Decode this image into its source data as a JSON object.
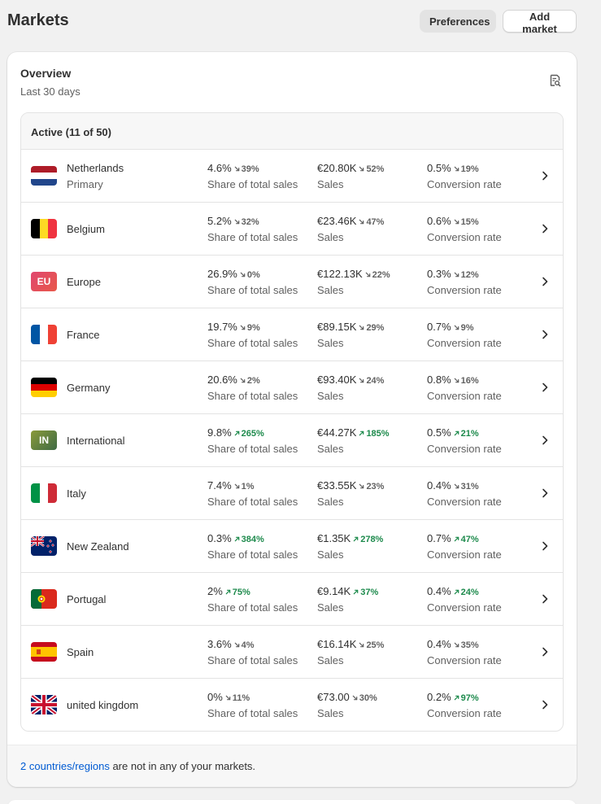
{
  "header": {
    "title": "Markets",
    "preferences_label": "Preferences",
    "add_market_label": "Add market"
  },
  "overview": {
    "title": "Overview",
    "period": "Last 30 days",
    "icon": "search-report-icon"
  },
  "active_section": {
    "heading": "Active (11 of 50)",
    "markets": [
      {
        "name": "Netherlands",
        "subtitle": "Primary",
        "flag": "nl",
        "share": "4.6%",
        "share_change": "39%",
        "share_dir": "down",
        "sales": "€20.80K",
        "sales_change": "52%",
        "sales_dir": "down",
        "conv": "0.5%",
        "conv_change": "19%",
        "conv_dir": "down"
      },
      {
        "name": "Belgium",
        "subtitle": "",
        "flag": "be",
        "share": "5.2%",
        "share_change": "32%",
        "share_dir": "down",
        "sales": "€23.46K",
        "sales_change": "47%",
        "sales_dir": "down",
        "conv": "0.6%",
        "conv_change": "15%",
        "conv_dir": "down"
      },
      {
        "name": "Europe",
        "subtitle": "",
        "flag": "eu",
        "share": "26.9%",
        "share_change": "0%",
        "share_dir": "down",
        "sales": "€122.13K",
        "sales_change": "22%",
        "sales_dir": "down",
        "conv": "0.3%",
        "conv_change": "12%",
        "conv_dir": "down"
      },
      {
        "name": "France",
        "subtitle": "",
        "flag": "fr",
        "share": "19.7%",
        "share_change": "9%",
        "share_dir": "down",
        "sales": "€89.15K",
        "sales_change": "29%",
        "sales_dir": "down",
        "conv": "0.7%",
        "conv_change": "9%",
        "conv_dir": "down"
      },
      {
        "name": "Germany",
        "subtitle": "",
        "flag": "de",
        "share": "20.6%",
        "share_change": "2%",
        "share_dir": "down",
        "sales": "€93.40K",
        "sales_change": "24%",
        "sales_dir": "down",
        "conv": "0.8%",
        "conv_change": "16%",
        "conv_dir": "down"
      },
      {
        "name": "International",
        "subtitle": "",
        "flag": "in",
        "share": "9.8%",
        "share_change": "265%",
        "share_dir": "up",
        "sales": "€44.27K",
        "sales_change": "185%",
        "sales_dir": "up",
        "conv": "0.5%",
        "conv_change": "21%",
        "conv_dir": "up"
      },
      {
        "name": "Italy",
        "subtitle": "",
        "flag": "it",
        "share": "7.4%",
        "share_change": "1%",
        "share_dir": "down",
        "sales": "€33.55K",
        "sales_change": "23%",
        "sales_dir": "down",
        "conv": "0.4%",
        "conv_change": "31%",
        "conv_dir": "down"
      },
      {
        "name": "New Zealand",
        "subtitle": "",
        "flag": "nz",
        "share": "0.3%",
        "share_change": "384%",
        "share_dir": "up",
        "sales": "€1.35K",
        "sales_change": "278%",
        "sales_dir": "up",
        "conv": "0.7%",
        "conv_change": "47%",
        "conv_dir": "up"
      },
      {
        "name": "Portugal",
        "subtitle": "",
        "flag": "pt",
        "share": "2%",
        "share_change": "75%",
        "share_dir": "up",
        "sales": "€9.14K",
        "sales_change": "37%",
        "sales_dir": "up",
        "conv": "0.4%",
        "conv_change": "24%",
        "conv_dir": "up"
      },
      {
        "name": "Spain",
        "subtitle": "",
        "flag": "es",
        "share": "3.6%",
        "share_change": "4%",
        "share_dir": "down",
        "sales": "€16.14K",
        "sales_change": "25%",
        "sales_dir": "down",
        "conv": "0.4%",
        "conv_change": "35%",
        "conv_dir": "down"
      },
      {
        "name": "united kingdom",
        "subtitle": "",
        "flag": "gb",
        "share": "0%",
        "share_change": "11%",
        "share_dir": "down",
        "sales": "€73.00",
        "sales_change": "30%",
        "sales_dir": "down",
        "conv": "0.2%",
        "conv_change": "97%",
        "conv_dir": "up"
      }
    ]
  },
  "labels": {
    "share": "Share of total sales",
    "sales": "Sales",
    "conv": "Conversion rate"
  },
  "flag_text": {
    "eu": "EU",
    "in": "IN"
  },
  "footer": {
    "link_text": "2 countries/regions",
    "rest_text": " are not in any of your markets."
  },
  "colors": {
    "up": "#1d8a4c",
    "down": "#616161",
    "link": "#005bd3"
  }
}
